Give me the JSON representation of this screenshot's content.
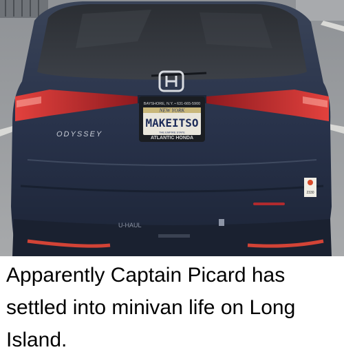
{
  "photo": {
    "description_hidden": "",
    "badge_model": "ODYSSEY",
    "plate_text": "MAKEITSO",
    "plate_state": "NEW YORK",
    "plate_top": "BAYSHORE, N.Y. • 631-665-5900",
    "plate_bottom": "ATLANTIC HONDA",
    "plate_frame_small": "THE EMPIRE STATE",
    "bumper_sticker": "U-HAUL",
    "parking_sticker": "2330"
  },
  "caption": {
    "text": "Apparently Captain Picard has settled into minivan life on Long Island."
  },
  "colors": {
    "van_body": "#2a3346",
    "taillight": "#c0272d",
    "background": "#ffffff",
    "caption_text": "#000000"
  }
}
